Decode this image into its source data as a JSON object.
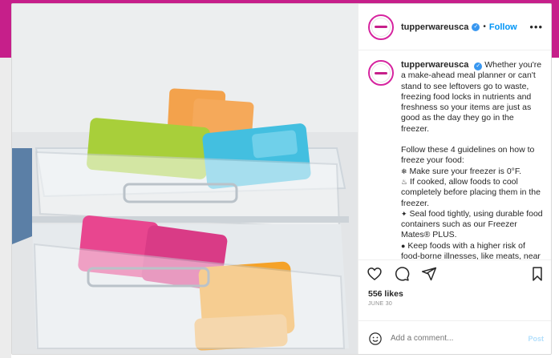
{
  "post": {
    "username": "tupperwareusca",
    "follow_label": "Follow",
    "caption": {
      "username": "tupperwareusca",
      "intro": "Whether you're a make-ahead meal planner or can't stand to see leftovers go to waste, freezing food locks in nutrients and freshness so your items are just as good as the day they go in the freezer.",
      "guidelines_intro": "Follow these 4 guidelines on how to freeze your food:",
      "tip1": "Make sure your freezer is 0°F.",
      "tip2": "If cooked, allow foods to cool completely before placing them in the freezer.",
      "tip3": "Seal food tightly, using durable food containers such as our Freezer Mates® PLUS.",
      "tip4": "Keep foods with a higher risk of food-borne illnesses, like meats, near the back of the freezer where the"
    },
    "likes": "556 likes",
    "date": "JUNE 30",
    "comment_placeholder": "Add a comment...",
    "post_button": "Post"
  },
  "colors": {
    "brand_pink": "#c61f8a",
    "link_blue": "#0095f6"
  },
  "icons": [
    "more-options-icon",
    "heart-icon",
    "comment-icon",
    "share-icon",
    "bookmark-icon",
    "emoji-icon"
  ]
}
